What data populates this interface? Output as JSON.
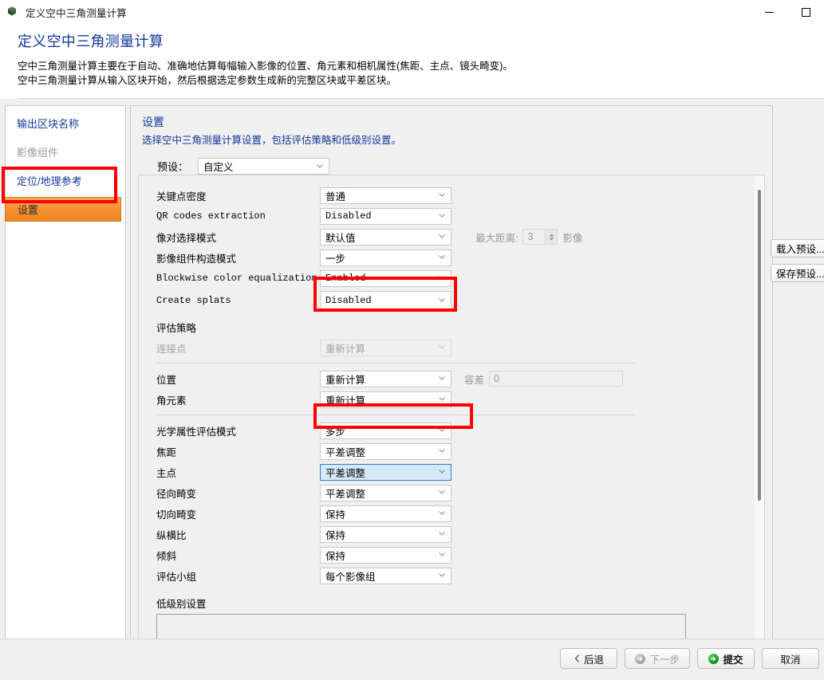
{
  "window": {
    "title": "定义空中三角测量计算",
    "icon": "cube-icon",
    "minimize_label": "",
    "maximize_label": ""
  },
  "header": {
    "heading": "定义空中三角测量计算",
    "description_line1": "空中三角测量计算主要在于自动、准确地估算每幅输入影像的位置、角元素和相机属性(焦距、主点、镜头畸变)。",
    "description_line2": "空中三角测量计算从输入区块开始，然后根据选定参数生成新的完整区块或平差区块。"
  },
  "sidebar": {
    "items": [
      {
        "label": "输出区块名称",
        "state": "link"
      },
      {
        "label": "影像组件",
        "state": "disabled"
      },
      {
        "label": "定位/地理参考",
        "state": "link"
      },
      {
        "label": "设置",
        "state": "current"
      }
    ]
  },
  "panel": {
    "title": "设置",
    "subtitle": "选择空中三角测量计算设置，包括评估策略和低级别设置。",
    "preset_label": "预设：",
    "preset_value": "自定义"
  },
  "side_buttons": [
    {
      "label": "载入预设..."
    },
    {
      "label": "保存预设..."
    }
  ],
  "settings": {
    "general_rows": [
      {
        "label": "关键点密度",
        "value": "普通",
        "mono": false,
        "disabled": false
      },
      {
        "label": "QR codes extraction",
        "value": "Disabled",
        "mono": true,
        "disabled": false
      },
      {
        "label": "像对选择模式",
        "value": "默认值",
        "mono": false,
        "disabled": false
      },
      {
        "label": "影像组件构造模式",
        "value": "一步",
        "mono": false,
        "disabled": false
      },
      {
        "label": "Blockwise color equalization",
        "value": "Enabled",
        "mono": true,
        "disabled": false
      },
      {
        "label": "Create splats",
        "value": "Disabled",
        "mono": true,
        "disabled": false
      }
    ],
    "max_distance": {
      "label": "最大距离:",
      "value": "3",
      "unit": "影像"
    },
    "strategy_header": "评估策略",
    "strategy_rows": [
      {
        "label": "连接点",
        "value": "重新计算",
        "disabled": true
      },
      {
        "label": "位置",
        "value": "重新计算",
        "disabled": false
      },
      {
        "label": "角元素",
        "value": "重新计算",
        "disabled": false
      }
    ],
    "tolerance": {
      "label": "容差",
      "value": "0"
    },
    "optical_rows": [
      {
        "label": "光学属性评估模式",
        "value": "多步",
        "focused": false
      },
      {
        "label": "焦距",
        "value": "平差调整",
        "focused": false
      },
      {
        "label": "主点",
        "value": "平差调整",
        "focused": true
      },
      {
        "label": "径向畸变",
        "value": "平差调整",
        "focused": false
      },
      {
        "label": "切向畸变",
        "value": "保持",
        "focused": false
      },
      {
        "label": "纵横比",
        "value": "保持",
        "focused": false
      },
      {
        "label": "倾斜",
        "value": "保持",
        "focused": false
      },
      {
        "label": "评估小组",
        "value": "每个影像组",
        "focused": false
      }
    ],
    "low_level_header": "低级别设置",
    "low_level_value": ""
  },
  "footer": {
    "buttons": [
      {
        "label": "后退",
        "icon": "chevron-left-icon",
        "state": "normal"
      },
      {
        "label": "下一步",
        "icon": "arrow-right-circle-grey-icon",
        "state": "disabled"
      },
      {
        "label": "提交",
        "icon": "arrow-right-circle-green-icon",
        "state": "primary"
      },
      {
        "label": "取消",
        "icon": "none",
        "state": "normal"
      }
    ]
  },
  "annotations": {
    "color": "#ff0000",
    "boxes": [
      {
        "name": "sidebar-settings-highlight"
      },
      {
        "name": "create-splats-highlight"
      },
      {
        "name": "optical-mode-highlight"
      }
    ]
  }
}
